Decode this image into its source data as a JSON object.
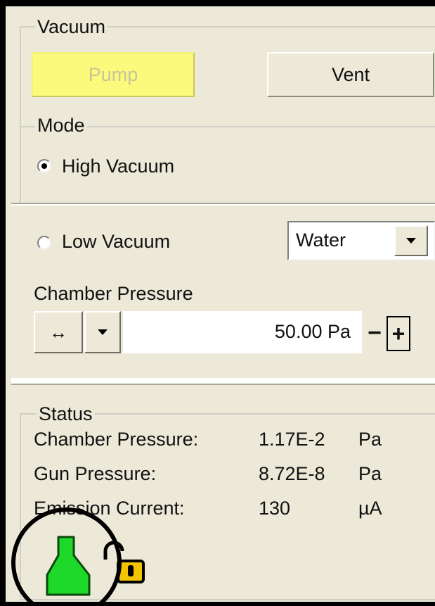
{
  "vacuum": {
    "group_label": "Vacuum",
    "pump_label": "Pump",
    "vent_label": "Vent",
    "mode_label": "Mode",
    "high_vacuum_label": "High Vacuum",
    "high_vacuum_selected": true,
    "low_vacuum_label": "Low Vacuum",
    "low_vacuum_selected": false,
    "gas_select_value": "Water",
    "chamber_pressure_label": "Chamber Pressure",
    "chamber_pressure_value": "50.00 Pa",
    "arrows_glyph": "↔",
    "minus_label": "−",
    "plus_label": "+"
  },
  "status": {
    "group_label": "Status",
    "rows": [
      {
        "label": "Chamber Pressure:",
        "value": "1.17E-2",
        "unit": "Pa"
      },
      {
        "label": "Gun Pressure:",
        "value": "8.72E-8",
        "unit": "Pa"
      },
      {
        "label": "Emission Current:",
        "value": "130",
        "unit": "µA"
      }
    ],
    "icons": [
      "vacuum-state-icon",
      "lock-icon"
    ]
  },
  "colors": {
    "panel": "#ece9d8",
    "pump_active": "#fbfa7c",
    "vacuum_ok_green": "#1ed82a",
    "lock_yellow": "#f2c400"
  }
}
